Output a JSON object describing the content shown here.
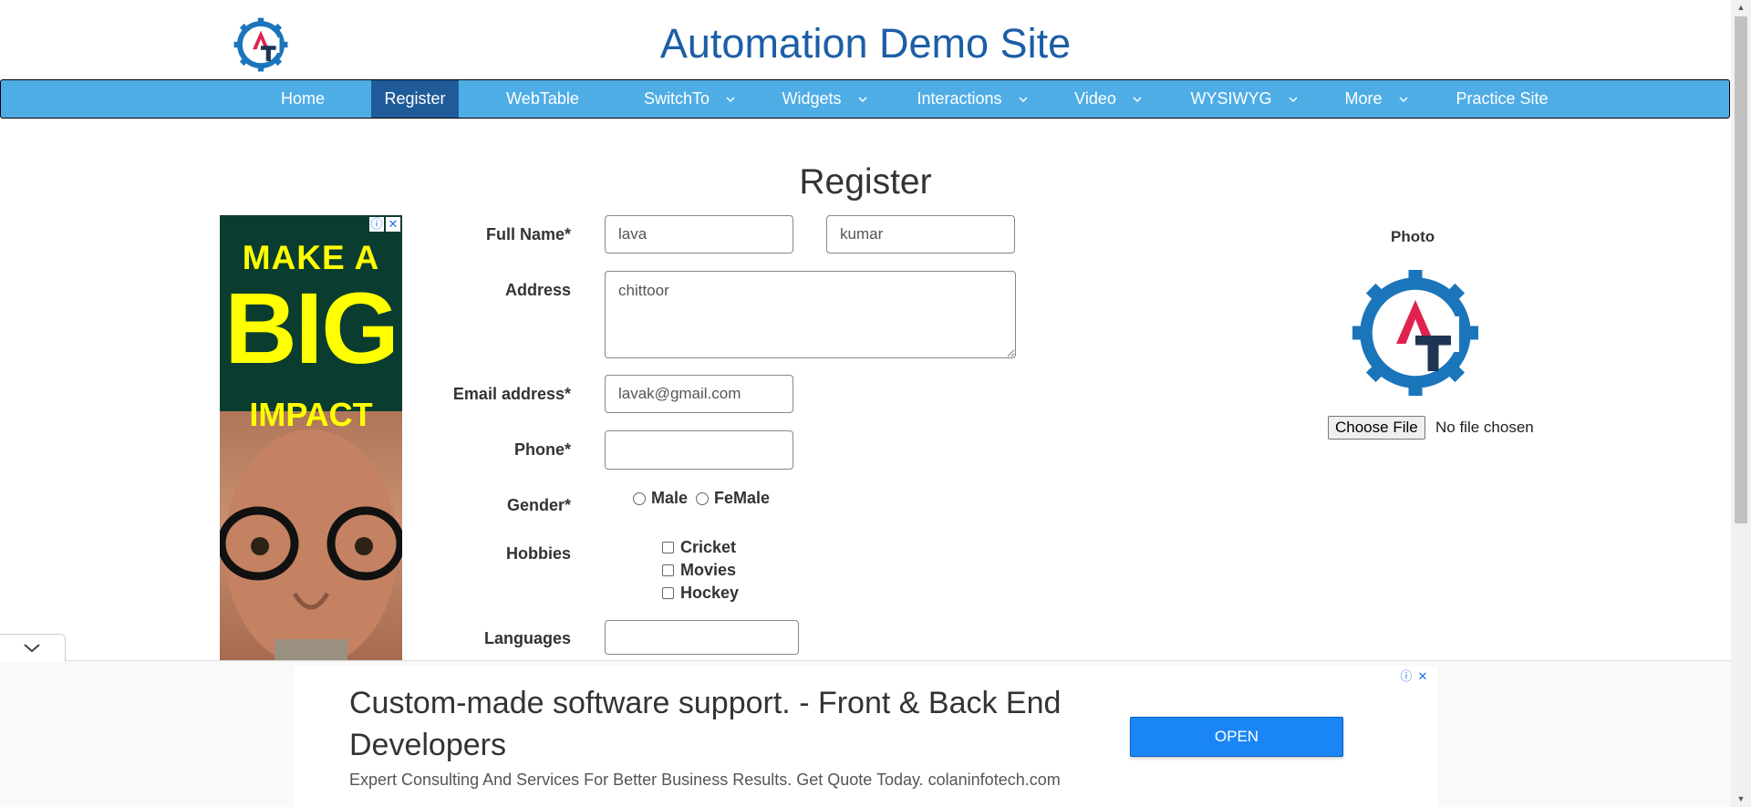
{
  "header": {
    "title": "Automation Demo Site",
    "logo_icon": "at-gear-logo-icon"
  },
  "nav": {
    "items": [
      {
        "label": "Home",
        "dropdown": false
      },
      {
        "label": "Register",
        "dropdown": false,
        "active": true
      },
      {
        "label": "WebTable",
        "dropdown": false
      },
      {
        "label": "SwitchTo",
        "dropdown": true
      },
      {
        "label": "Widgets",
        "dropdown": true
      },
      {
        "label": "Interactions",
        "dropdown": true
      },
      {
        "label": "Video",
        "dropdown": true
      },
      {
        "label": "WYSIWYG",
        "dropdown": true
      },
      {
        "label": "More",
        "dropdown": true
      },
      {
        "label": "Practice Site",
        "dropdown": false
      }
    ],
    "bg_color": "#4fade6",
    "active_color": "#1f5b99"
  },
  "form": {
    "heading": "Register",
    "full_name_label": "Full Name*",
    "first_name_value": "lava",
    "last_name_value": "kumar",
    "address_label": "Address",
    "address_value": "chittoor",
    "email_label": "Email address*",
    "email_value": "lavak@gmail.com",
    "phone_label": "Phone*",
    "phone_value": "",
    "gender_label": "Gender*",
    "gender_options": [
      "Male",
      "FeMale"
    ],
    "hobbies_label": "Hobbies",
    "hobbies": [
      "Cricket",
      "Movies",
      "Hockey"
    ],
    "languages_label": "Languages",
    "languages_value": ""
  },
  "photo": {
    "label": "Photo",
    "choose_button": "Choose File",
    "status": "No file chosen"
  },
  "side_ad": {
    "line1": "MAKE A",
    "line2": "BIG",
    "line3": "IMPACT",
    "text_color": "#ffff00"
  },
  "bottom_ad": {
    "headline": "Custom-made software support. - Front & Back End Developers",
    "subtext": "Expert Consulting And Services For Better Business Results. Get Quote Today. colaninfotech.com",
    "cta": "OPEN",
    "cta_color": "#1a86f6"
  },
  "icons": {
    "ad_info": "ⓘ",
    "ad_close": "✕"
  }
}
